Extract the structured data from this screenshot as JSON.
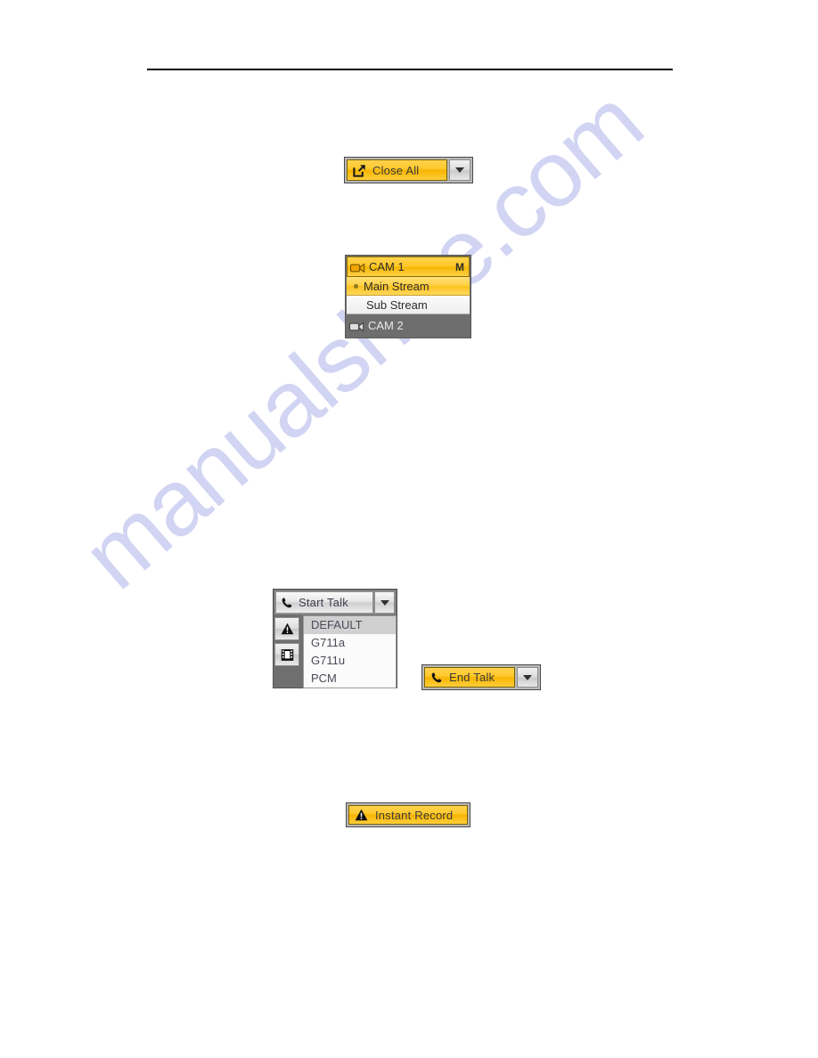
{
  "page": {
    "background_color": "#ffffff",
    "watermark_text": "manualshive.com",
    "watermark_color": "#c9cdf0",
    "header_rule_color": "#000000"
  },
  "close_all_button": {
    "label": "Close All",
    "icon": "external-link-icon",
    "dropdown_icon": "chevron-down-icon",
    "face_color": "#ffc92e",
    "border_color": "#4a4a4a"
  },
  "cam_menu": {
    "header": {
      "label": "CAM 1",
      "right_badge": "M",
      "icon": "video-camera-icon"
    },
    "stream_options": [
      {
        "label": "Main Stream",
        "selected": true,
        "bullet": "radio-dot-icon"
      },
      {
        "label": "Sub Stream",
        "selected": false,
        "bullet": ""
      }
    ],
    "next_camera": {
      "label": "CAM 2",
      "icon": "video-camera-icon"
    },
    "accent_color": "#ffc524",
    "panel_color": "#6e6e6e"
  },
  "start_talk_panel": {
    "button": {
      "label": "Start Talk",
      "icon": "phone-icon",
      "dropdown_icon": "chevron-down-icon"
    },
    "side_icons": [
      {
        "name": "warning-triangle-icon"
      },
      {
        "name": "film-strip-icon"
      }
    ],
    "codec_options": [
      {
        "label": "DEFAULT",
        "highlighted": true
      },
      {
        "label": "G711a",
        "highlighted": false
      },
      {
        "label": "G711u",
        "highlighted": false
      },
      {
        "label": "PCM",
        "highlighted": false
      }
    ],
    "panel_color": "#6f6f6f",
    "list_background": "#fbfbfb",
    "highlight_color": "#d0d0d0"
  },
  "end_talk_button": {
    "label": "End Talk",
    "icon": "phone-icon",
    "dropdown_icon": "chevron-down-icon",
    "face_color": "#ffc92e"
  },
  "instant_record_button": {
    "label": "Instant Record",
    "icon": "warning-triangle-icon",
    "face_color": "#ffc92e"
  }
}
